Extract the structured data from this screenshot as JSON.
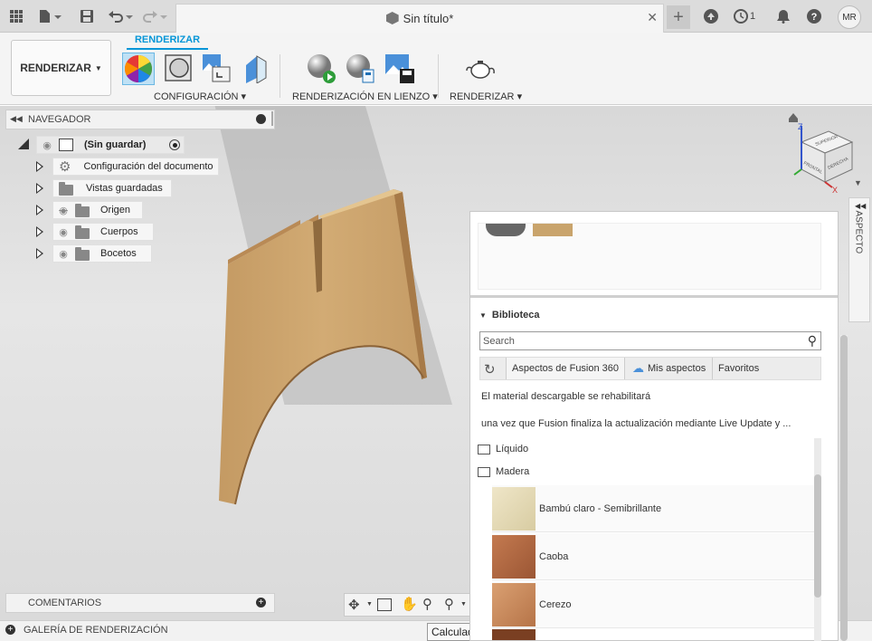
{
  "titlebar": {
    "doc_title": "Sin título*",
    "job_count": "1",
    "user_initials": "MR"
  },
  "toolbar": {
    "workspace_button": "RENDERIZAR",
    "active_tab": "RENDERIZAR",
    "groups": {
      "config": "CONFIGURACIÓN",
      "canvas_render": "RENDERIZACIÓN EN LIENZO",
      "render": "RENDERIZAR"
    }
  },
  "navigator": {
    "title": "NAVEGADOR",
    "root": "(Sin guardar)",
    "items": [
      {
        "label": "Configuración del documento"
      },
      {
        "label": "Vistas guardadas"
      },
      {
        "label": "Origen"
      },
      {
        "label": "Cuerpos"
      },
      {
        "label": "Bocetos"
      }
    ]
  },
  "viewcube": {
    "labels": [
      "SUPERIOR",
      "FRONTAL",
      "DERECHA"
    ],
    "axis_x": "X",
    "axis_z": "Z"
  },
  "comments": {
    "title": "COMENTARIOS"
  },
  "gallery": {
    "title": "GALERÍA DE RENDERIZACIÓN"
  },
  "tooltip": "Calculadora",
  "aspect_panel": {
    "side_tab": "ASPECTO",
    "library_title": "Biblioteca",
    "search_placeholder": "Search",
    "tabs": [
      "Aspectos de Fusion 360",
      "Mis aspectos",
      "Favoritos"
    ],
    "notice_line1": "El material descargable se rehabilitará",
    "notice_line2": "una vez que Fusion finaliza la actualización mediante Live Update y ...",
    "folders": [
      "Líquido",
      "Madera"
    ],
    "materials": [
      {
        "name": "Bambú claro - Semibrillante",
        "color": "#e6dcb8"
      },
      {
        "name": "Caoba",
        "color": "#b06a44"
      },
      {
        "name": "Cerezo",
        "color": "#c98a5a"
      }
    ]
  },
  "colors": {
    "accent": "#0696d7",
    "wood": "#c9a46c"
  }
}
